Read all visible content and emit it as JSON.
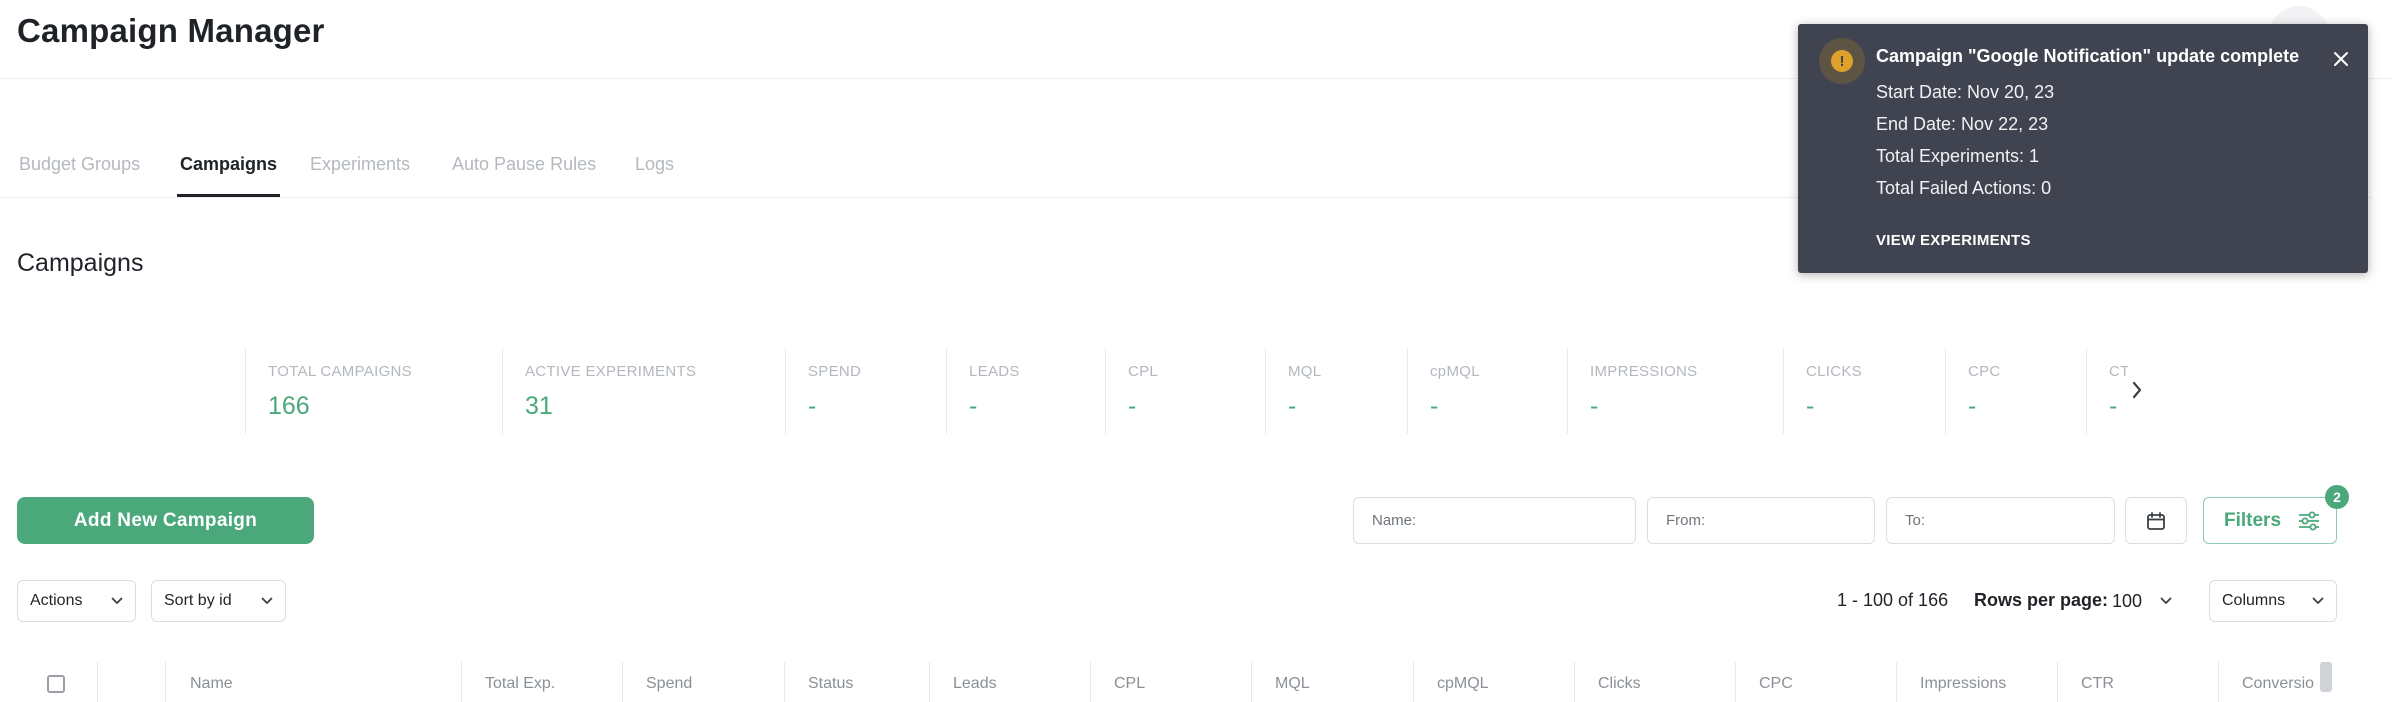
{
  "app": {
    "title": "Campaign Manager"
  },
  "tabs": [
    {
      "label": "Budget Groups",
      "active": false
    },
    {
      "label": "Campaigns",
      "active": true
    },
    {
      "label": "Experiments",
      "active": false
    },
    {
      "label": "Auto Pause Rules",
      "active": false
    },
    {
      "label": "Logs",
      "active": false
    }
  ],
  "section": {
    "title": "Campaigns"
  },
  "metrics": [
    {
      "label": "TOTAL CAMPAIGNS",
      "value": "166"
    },
    {
      "label": "ACTIVE EXPERIMENTS",
      "value": "31"
    },
    {
      "label": "SPEND",
      "value": "-"
    },
    {
      "label": "LEADS",
      "value": "-"
    },
    {
      "label": "CPL",
      "value": "-"
    },
    {
      "label": "MQL",
      "value": "-"
    },
    {
      "label": "cpMQL",
      "value": "-"
    },
    {
      "label": "IMPRESSIONS",
      "value": "-"
    },
    {
      "label": "CLICKS",
      "value": "-"
    },
    {
      "label": "CPC",
      "value": "-"
    },
    {
      "label": "CT",
      "value": "-"
    }
  ],
  "toolbar": {
    "add_label": "Add New Campaign",
    "name_placeholder": "Name:",
    "from_placeholder": "From:",
    "to_placeholder": "To:",
    "filters_label": "Filters",
    "filters_count": "2",
    "actions_label": "Actions",
    "sort_label": "Sort by id",
    "columns_label": "Columns"
  },
  "pagination": {
    "range": "1 - 100 of 166",
    "rows_label": "Rows per page:",
    "rows_value": "100"
  },
  "table": {
    "columns": [
      "Name",
      "Total Exp.",
      "Spend",
      "Status",
      "Leads",
      "CPL",
      "MQL",
      "cpMQL",
      "Clicks",
      "CPC",
      "Impressions",
      "CTR",
      "Conversio"
    ]
  },
  "toast": {
    "title": "Campaign \"Google Notification\" update complete",
    "lines": [
      "Start Date: Nov 20, 23",
      "End Date: Nov 22, 23",
      "Total Experiments: 1",
      "Total Failed Actions: 0"
    ],
    "action_label": "VIEW EXPERIMENTS",
    "icon_glyph": "!"
  },
  "colors": {
    "accent": "#4aa87a",
    "toast_bg": "#3f4450",
    "warning": "#e0a12a"
  }
}
